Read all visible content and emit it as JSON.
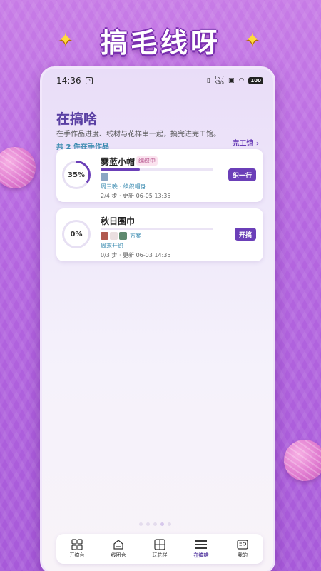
{
  "banner": {
    "title": "搞毛线呀",
    "sparkle_icon": "sparkle-icon"
  },
  "status": {
    "time": "14:36",
    "speed_top": "15.7",
    "speed_bottom": "KB/s",
    "battery": "100"
  },
  "header": {
    "title": "在搞啥",
    "subtitle": "在手作品进度、线材与花样串一起，搞完进完工馆。",
    "count": "共 2 件在手作品",
    "done_link": "完工馆 ›"
  },
  "projects": [
    {
      "name": "雾蓝小帽",
      "tag": "编织中",
      "progress_label": "35%",
      "progress": 0.35,
      "swatches": [
        "#8aa6c4"
      ],
      "plan": "周三晚 · 续织帽身",
      "meta": "2/4 步 · 更新 06-05 13:35",
      "action": "织一行"
    },
    {
      "name": "秋日围巾",
      "progress_label": "0%",
      "progress": 0,
      "swatches": [
        "#b05a4e",
        "#eadfe0",
        "#5f8a6e"
      ],
      "swatch_label": "方案",
      "plan": "周末开织",
      "meta": "0/3 步 · 更新 06-03 14:35",
      "action": "开搞"
    }
  ],
  "tabs": [
    {
      "label": "开搞台",
      "icon": "grid-icon"
    },
    {
      "label": "线团仓",
      "icon": "home-icon"
    },
    {
      "label": "玩花样",
      "icon": "calculator-icon"
    },
    {
      "label": "在搞啥",
      "icon": "menu-icon",
      "active": true
    },
    {
      "label": "我的",
      "icon": "profile-card-icon"
    }
  ],
  "colors": {
    "accent": "#6b3fb8",
    "teal": "#3a8bb0",
    "background": "#b566e0"
  }
}
